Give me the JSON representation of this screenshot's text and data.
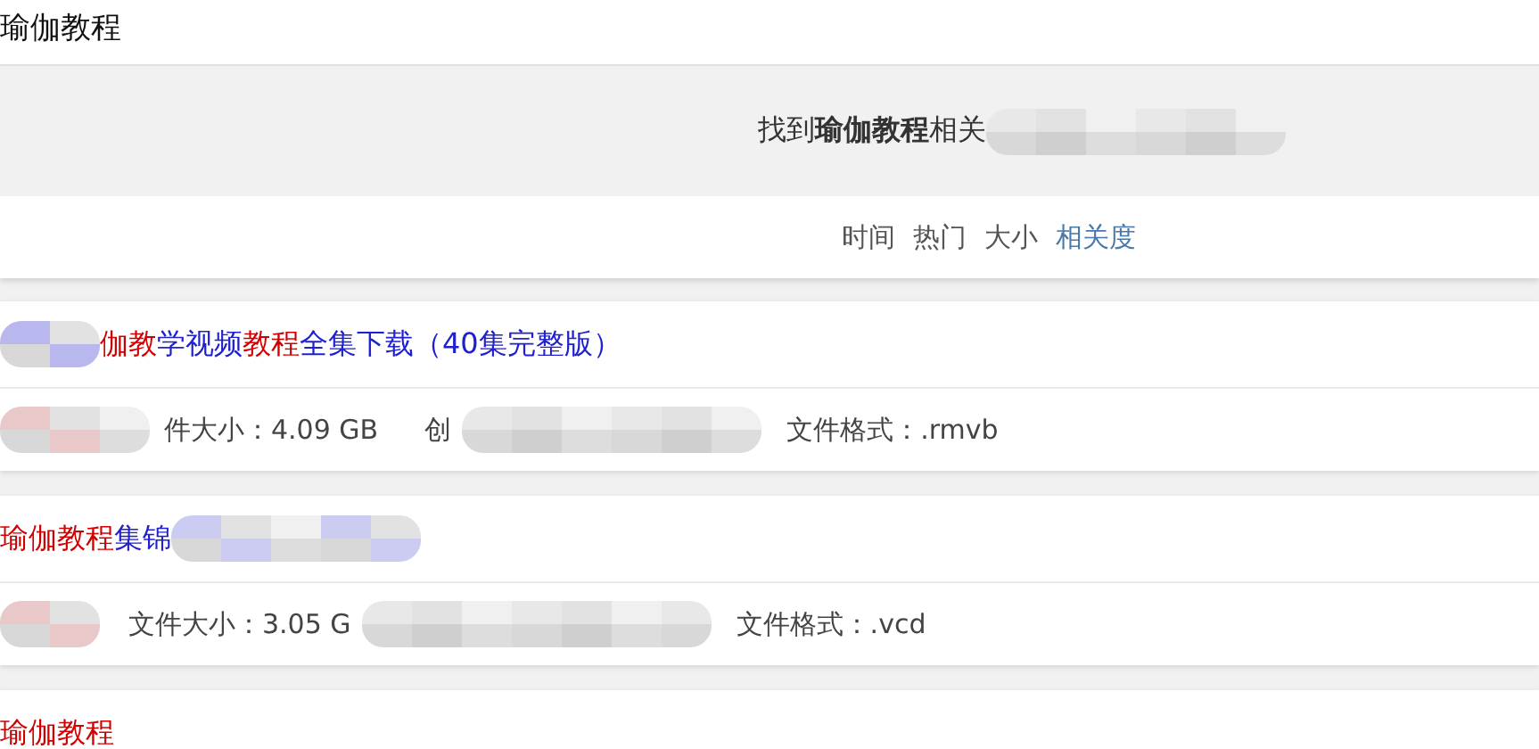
{
  "page_title": "瑜伽教程",
  "summary": "找到**瑜伽教程**相关",
  "sort_options": [
    {
      "label": "时间",
      "selected": false
    },
    {
      "label": "热门",
      "selected": false
    },
    {
      "label": "大小",
      "selected": false
    },
    {
      "label": "相关度",
      "selected": true
    }
  ],
  "results": [
    {
      "title": [
        {
          "text": "伽教",
          "highlight": true
        },
        {
          "text": "学视频",
          "highlight": false
        },
        {
          "text": "教程",
          "highlight": true
        },
        {
          "text": "全集下载（40集完整版）",
          "highlight": false
        }
      ],
      "size": "件大小：4.09 GB",
      "created": "创",
      "format": "文件格式：.rmvb"
    },
    {
      "title": [
        {
          "text": "瑜伽教程",
          "highlight": true
        },
        {
          "text": "集锦",
          "highlight": false
        }
      ],
      "size": "文件大小：3.05 G",
      "format": "文件格式：.vcd"
    },
    {
      "title": [
        {
          "text": "瑜伽教程",
          "highlight": true
        }
      ]
    }
  ]
}
